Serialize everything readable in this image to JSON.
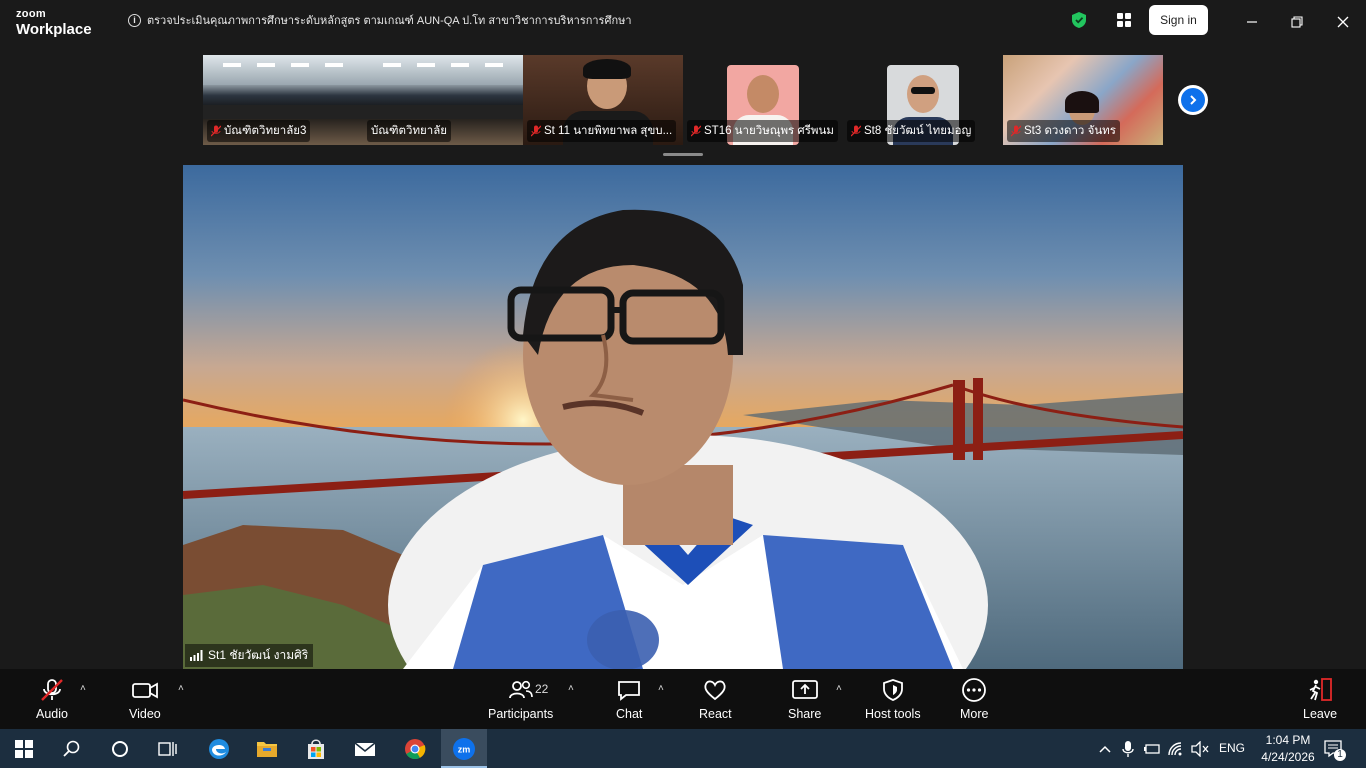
{
  "app": {
    "brand_top": "zoom",
    "brand_bottom": "Workplace"
  },
  "meeting": {
    "title": "ตรวจประเมินคุณภาพการศึกษาระดับหลักสูตร ตามเกณฑ์ AUN-QA ป.โท สาขาวิชาการบริหารการศึกษา"
  },
  "header": {
    "signin_label": "Sign in"
  },
  "thumbnails": [
    {
      "name": "บัณฑิตวิทยาลัย3",
      "muted": true
    },
    {
      "name": "บัณฑิตวิทยาลัย",
      "muted": false
    },
    {
      "name": "St 11 นายพิทยาพล สุขบ...",
      "muted": true
    },
    {
      "name": "ST16 นายวิษณุพร ศรีพนม",
      "muted": true
    },
    {
      "name": "St8 ชัยวัฒน์ ไทยมอญ",
      "muted": true
    },
    {
      "name": "St3 ดวงดาว จันทร",
      "muted": true
    }
  ],
  "main_video": {
    "speaker_name": "St1 ชัยวัฒน์ งามศิริ"
  },
  "toolbar": {
    "audio_label": "Audio",
    "video_label": "Video",
    "participants_label": "Participants",
    "participants_count": "22",
    "chat_label": "Chat",
    "react_label": "React",
    "share_label": "Share",
    "host_tools_label": "Host tools",
    "more_label": "More",
    "leave_label": "Leave"
  },
  "taskbar": {
    "language": "ENG",
    "time": "1:04 PM",
    "date": "4/24/2026",
    "notification_count": "1"
  },
  "colors": {
    "zoom_blue": "#0e71eb",
    "leave_red": "#e02828",
    "shield_green": "#22c55e",
    "mute_red": "#e02828"
  }
}
